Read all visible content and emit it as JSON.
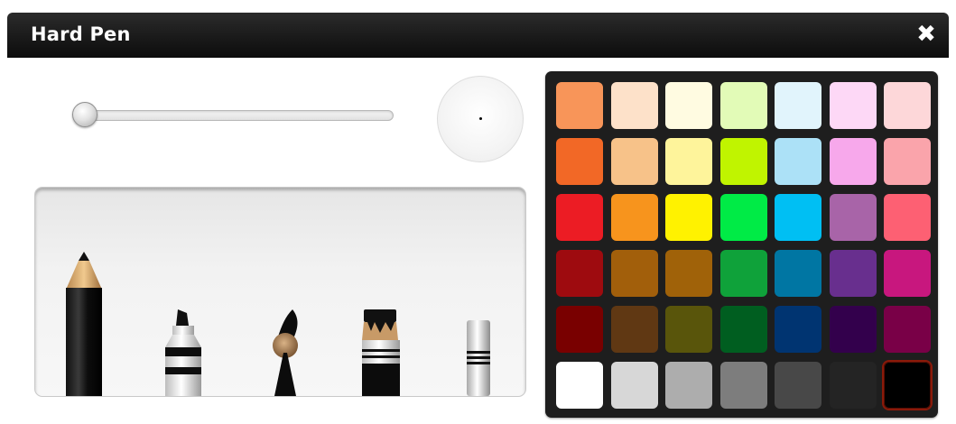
{
  "window": {
    "title": "Hard Pen",
    "close_icon": "close-x-icon"
  },
  "brush_size": {
    "value_fraction": 0.0
  },
  "tools": [
    {
      "name": "pencil",
      "icon": "pencil-icon",
      "selected": true
    },
    {
      "name": "marker",
      "icon": "marker-icon"
    },
    {
      "name": "paintbrush",
      "icon": "paintbrush-icon"
    },
    {
      "name": "flat-brush",
      "icon": "flat-brush-icon"
    },
    {
      "name": "eraser",
      "icon": "eraser-icon"
    }
  ],
  "palette": {
    "selected": "#000000",
    "rows": [
      [
        "#F89559",
        "#FDE1C9",
        "#FFFBE1",
        "#E2FBB7",
        "#E1F4FC",
        "#FDD8F6",
        "#FDD7D9"
      ],
      [
        "#F26826",
        "#F7C289",
        "#FEF49B",
        "#C0F400",
        "#ACE1F7",
        "#F7A8EB",
        "#FAA4AB"
      ],
      [
        "#EC1C24",
        "#F7941D",
        "#FFF200",
        "#00EB46",
        "#00BFF3",
        "#A864A8",
        "#FD6073"
      ],
      [
        "#9E0B0F",
        "#A25F0B",
        "#A06209",
        "#0FA23A",
        "#0076A3",
        "#682F8E",
        "#C8177E"
      ],
      [
        "#790000",
        "#603813",
        "#59550B",
        "#005E20",
        "#003471",
        "#33004C",
        "#790047"
      ],
      [
        "#FFFFFF",
        "#D7D7D7",
        "#ADADAD",
        "#7D7D7D",
        "#484848",
        "#242424",
        "#000000"
      ]
    ]
  }
}
